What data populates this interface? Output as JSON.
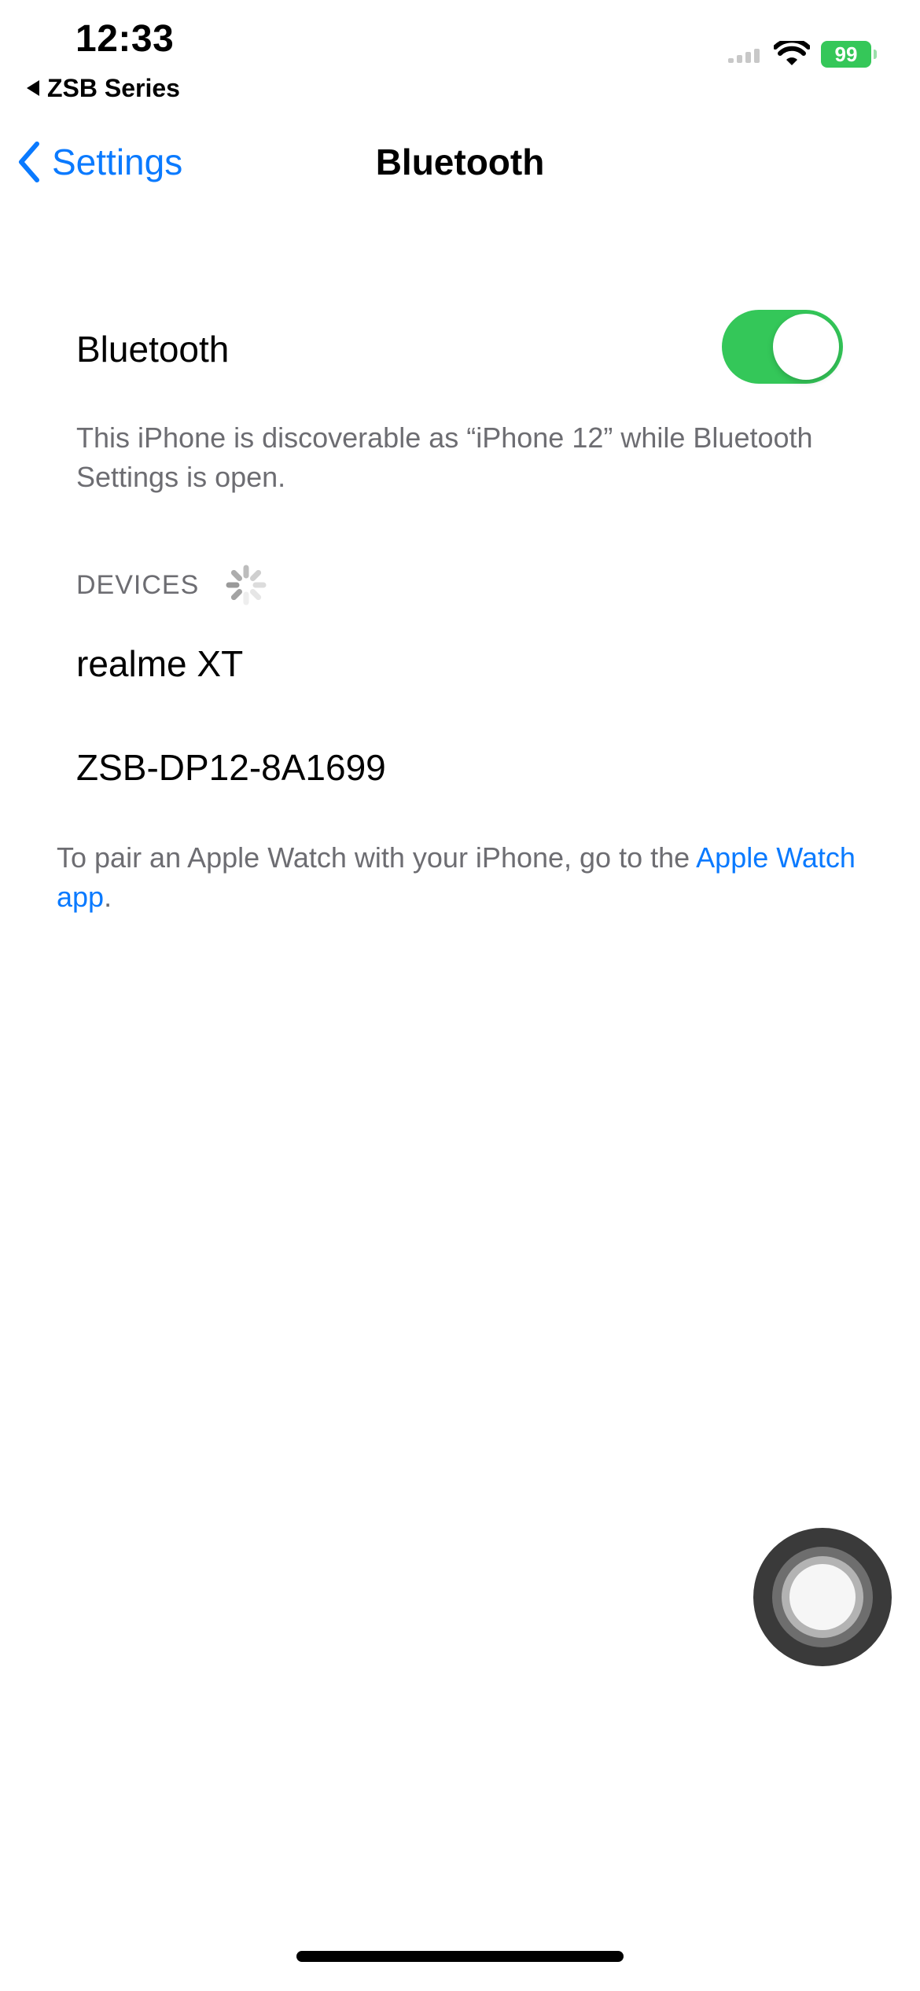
{
  "status_bar": {
    "time": "12:33",
    "back_app": "ZSB Series",
    "battery": "99",
    "icons": [
      "cellular-signal-icon",
      "wifi-icon",
      "battery-charging-icon"
    ]
  },
  "nav": {
    "back_label": "Settings",
    "title": "Bluetooth"
  },
  "bluetooth": {
    "label": "Bluetooth",
    "enabled": true,
    "discoverable_note": "This iPhone is discoverable as “iPhone 12” while Bluetooth Settings is open."
  },
  "devices": {
    "header": "DEVICES",
    "items": [
      {
        "name": "realme XT"
      },
      {
        "name": "ZSB-DP12-8A1699"
      }
    ]
  },
  "watch_note": {
    "text": "To pair an Apple Watch with your iPhone, go to the ",
    "link": "Apple Watch app",
    "suffix": "."
  },
  "colors": {
    "accent": "#0a7aff",
    "toggle_on": "#34c759",
    "secondary_text": "#6d6d72"
  }
}
